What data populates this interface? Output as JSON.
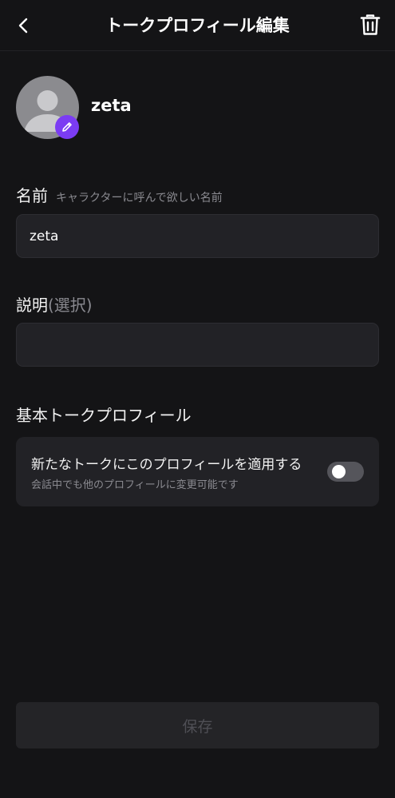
{
  "header": {
    "title": "トークプロフィール編集",
    "back_icon": "chevron-left-icon",
    "delete_icon": "trash-icon"
  },
  "profile": {
    "name": "zeta",
    "edit_icon": "pencil-icon"
  },
  "name_field": {
    "label": "名前",
    "hint": "キャラクターに呼んで欲しい名前",
    "value": "zeta"
  },
  "description_field": {
    "label": "説明",
    "optional": "(選択)",
    "value": ""
  },
  "default_profile": {
    "title": "基本トークプロフィール",
    "toggle_label": "新たなトークにこのプロフィールを適用する",
    "toggle_hint": "会話中でも他のプロフィールに変更可能です",
    "toggle_on": false
  },
  "save_button": {
    "label": "保存"
  },
  "colors": {
    "background": "#141416",
    "field": "#222226",
    "accent": "#7b3cf3",
    "muted_text": "#8a8a90"
  }
}
